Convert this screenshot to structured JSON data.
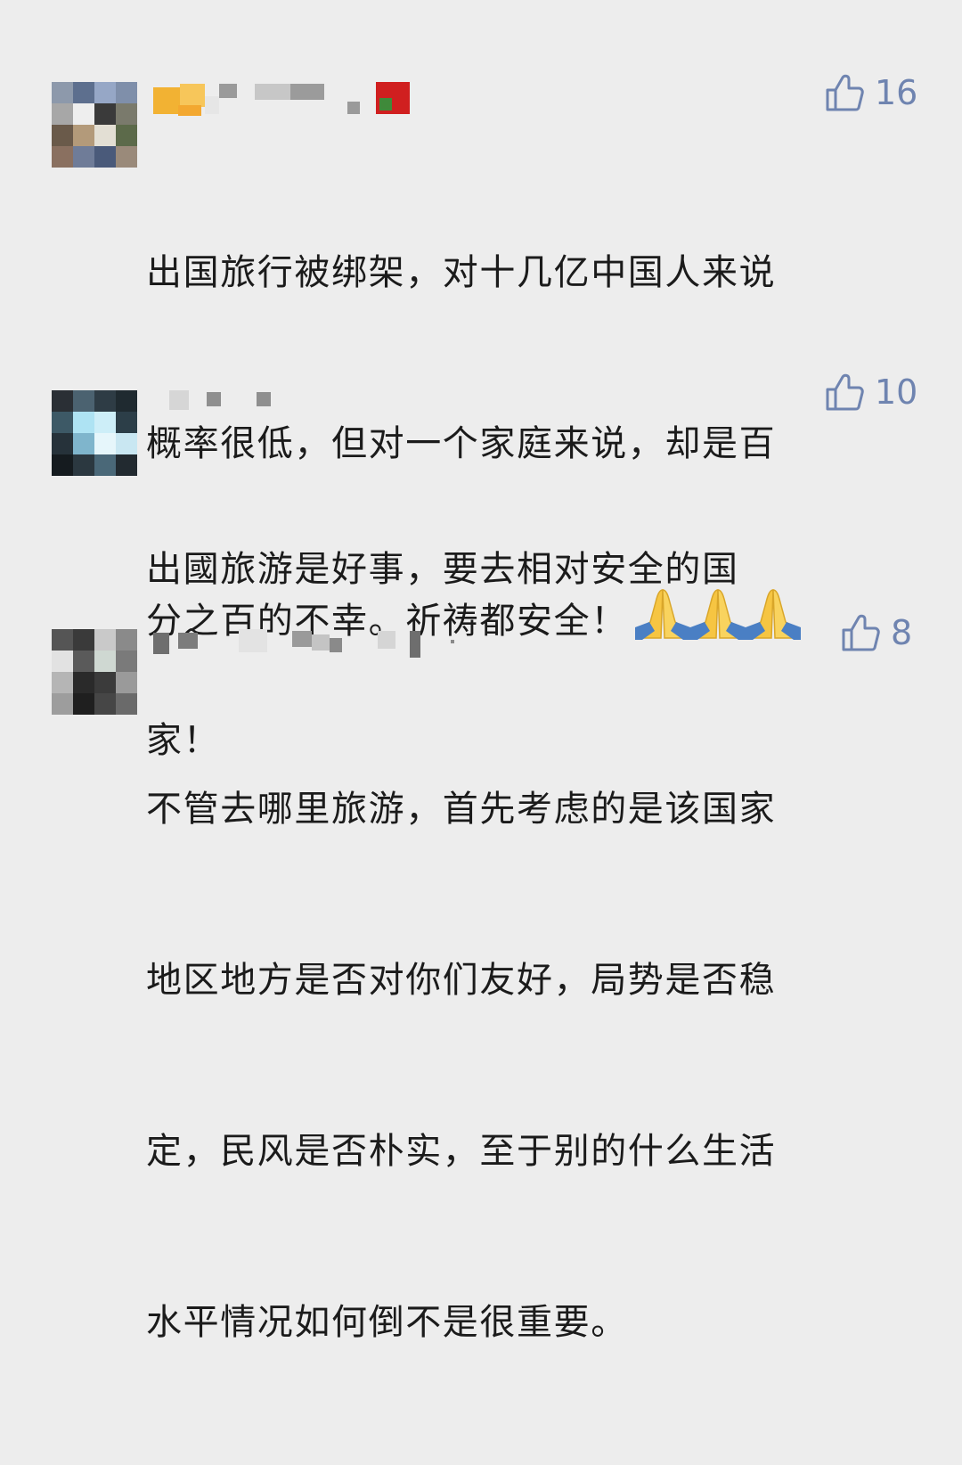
{
  "comments": [
    {
      "likes": "16",
      "lines": [
        "出国旅行被绑架，对十几亿中国人来说",
        "概率很低，但对一个家庭来说，却是百",
        "分之百的不幸。祈祷都安全！"
      ],
      "emoji": [
        "folded-hands-emoji",
        "folded-hands-emoji",
        "folded-hands-emoji"
      ],
      "avatar_colors": [
        "#8d99ab",
        "#5d6f8e",
        "#96a7c6",
        "#7f8faa",
        "#a7a7a7",
        "#eeeeee",
        "#3a3a3a",
        "#7a7a6c",
        "#6a5a4a",
        "#b39a7a",
        "#e3dfd4",
        "#5c6a4a",
        "#8a7060",
        "#6f7c98",
        "#4a5a7a",
        "#9a8a7a"
      ]
    },
    {
      "likes": "10",
      "lines": [
        "出國旅游是好事，要去相对安全的国",
        "家！"
      ],
      "avatar_colors": [
        "#2a2f35",
        "#4b6270",
        "#2e3c45",
        "#1f2a30",
        "#3d5966",
        "#aee3f3",
        "#cdeef8",
        "#2c3e48",
        "#26323a",
        "#7fb5cc",
        "#e6f6fb",
        "#c9e7f2",
        "#151b1f",
        "#2b3840",
        "#4a6878",
        "#222a30"
      ]
    },
    {
      "likes": "8",
      "lines": [
        "不管去哪里旅游，首先考虑的是该国家",
        "地区地方是否对你们友好，局势是否稳",
        "定，民风是否朴实，至于别的什么生活",
        "水平情况如何倒不是很重要。"
      ],
      "avatar_colors": [
        "#555555",
        "#3a3a3a",
        "#c9c9c9",
        "#8a8a8a",
        "#e2e2e2",
        "#5a5a5a",
        "#cfd8d2",
        "#7a7a7a",
        "#b5b5b5",
        "#2a2a2a",
        "#3b3b3b",
        "#9a9a9a",
        "#9d9d9d",
        "#1f1f1f",
        "#464646",
        "#6a6a6a"
      ]
    }
  ],
  "colors": {
    "background": "#ededed",
    "text": "#1b1b1b",
    "like": "#6f84b0"
  }
}
